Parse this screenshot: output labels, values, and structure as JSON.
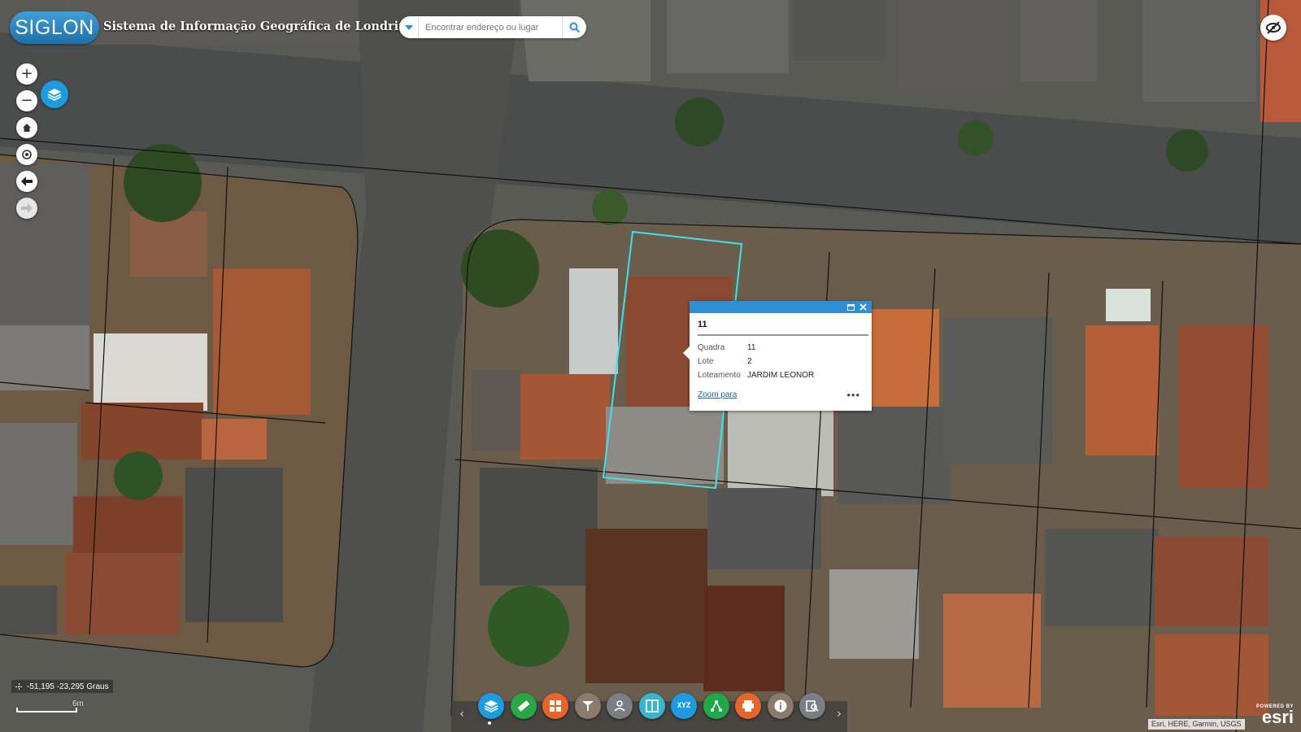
{
  "header": {
    "logo_text": "SIGLON",
    "title": "Sistema de Informação Geográfica de Londrina",
    "search_placeholder": "Encontrar endereço ou lugar"
  },
  "map_controls": {
    "zoom_in": "+",
    "zoom_out": "−"
  },
  "popup": {
    "title": "11",
    "fields": [
      {
        "label": "Quadra",
        "value": "11"
      },
      {
        "label": "Lote",
        "value": "2"
      },
      {
        "label": "Loteamento",
        "value": "JARDIM LEONOR"
      }
    ],
    "zoom_link": "Zoom para",
    "more": "•••"
  },
  "status": {
    "coordinates": "-51,195 -23,295 Graus",
    "scale_label": "6m"
  },
  "widgets": [
    {
      "name": "layers-widget",
      "color": "#1e9be0",
      "icon": "layers-icon"
    },
    {
      "name": "measure-widget",
      "color": "#28a745",
      "icon": "ruler-icon"
    },
    {
      "name": "basemap-gallery-widget",
      "color": "#e8642b",
      "icon": "grid-icon"
    },
    {
      "name": "select-widget",
      "color": "#8b7b6b",
      "icon": "select-cursor-icon"
    },
    {
      "name": "directions-widget",
      "color": "#7a7f86",
      "icon": "route-icon"
    },
    {
      "name": "swipe-widget",
      "color": "#3cb3d1",
      "icon": "swipe-icon"
    },
    {
      "name": "coordinate-widget",
      "color": "#1e9be0",
      "icon": "xyz-icon",
      "label": "XYZ"
    },
    {
      "name": "share-widget",
      "color": "#21a64a",
      "icon": "share-icon"
    },
    {
      "name": "print-widget",
      "color": "#e8642b",
      "icon": "printer-icon"
    },
    {
      "name": "about-widget",
      "color": "#8b7b6b",
      "icon": "info-icon"
    },
    {
      "name": "query-widget",
      "color": "#7a7f86",
      "icon": "query-icon"
    }
  ],
  "attribution": "Esri, HERE, Garmin, USGS",
  "esri_logo": {
    "powered_by": "POWERED BY",
    "name": "esri"
  },
  "colors": {
    "accent": "#1e9be0",
    "popup_bar": "#2d8fd6",
    "parcel_highlight": "#3fe0ea"
  }
}
